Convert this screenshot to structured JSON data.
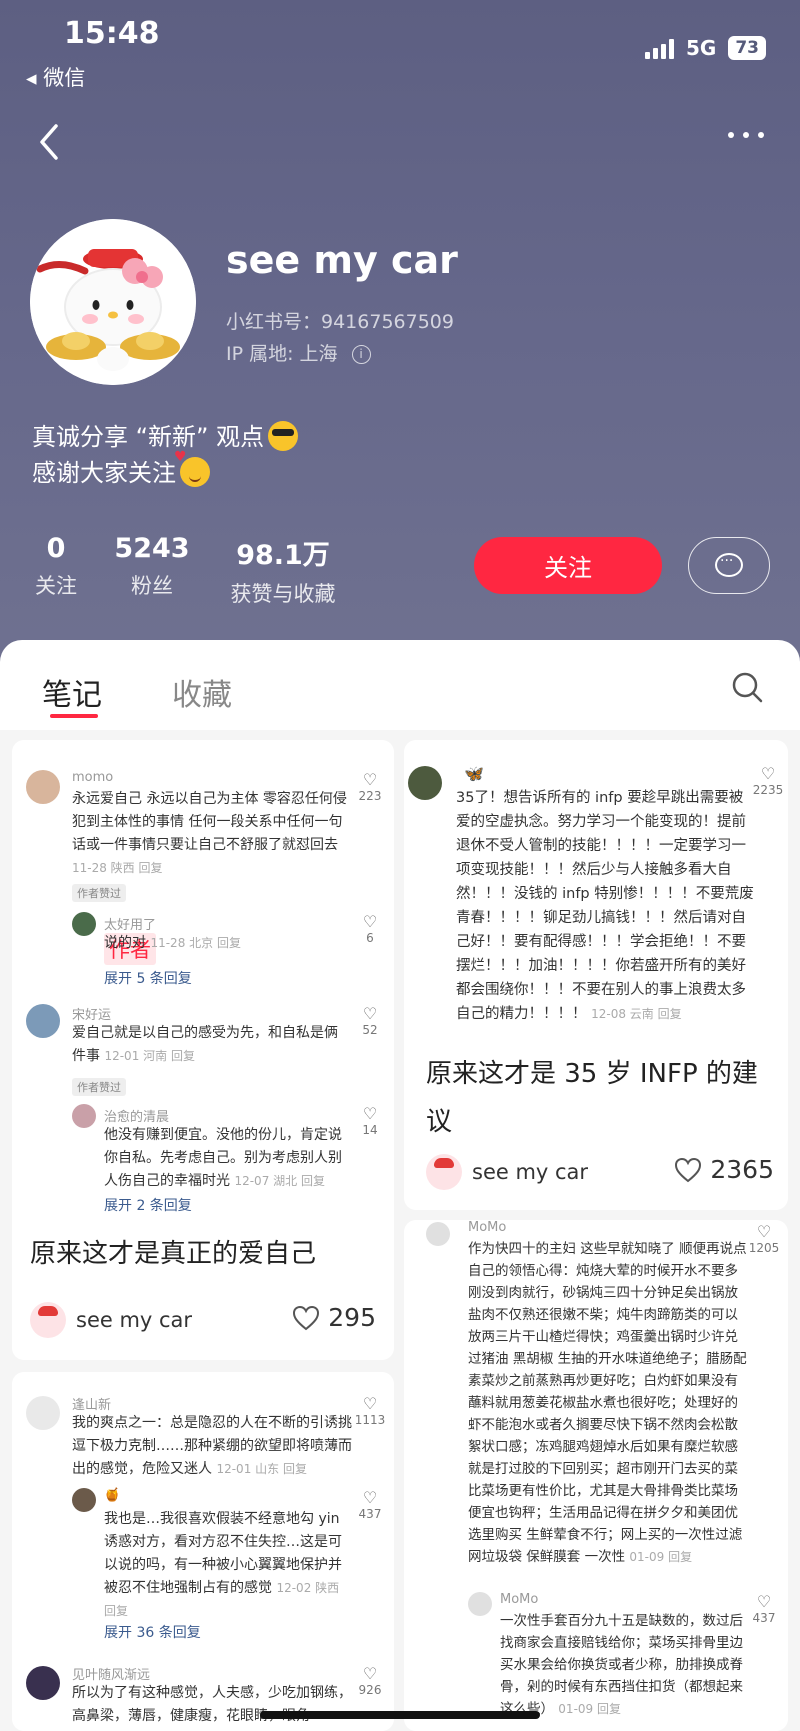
{
  "status": {
    "time": "15:48",
    "back_app": "微信",
    "network": "5G",
    "battery": "73"
  },
  "profile": {
    "name": "see my car",
    "id_line": "小红书号：94167567509",
    "ip_line": "IP 属地: 上海",
    "bio_line1": "真诚分享 “新新” 观点",
    "bio_line2": "感谢大家关注"
  },
  "stats": [
    {
      "num": "0",
      "label": "关注"
    },
    {
      "num": "5243",
      "label": "粉丝"
    },
    {
      "num": "98.1万",
      "label": "获赞与收藏"
    }
  ],
  "follow_label": "关注",
  "tabs": {
    "notes": "笔记",
    "collections": "收藏"
  },
  "cards": {
    "c1": {
      "comments": [
        {
          "name": "momo",
          "text": "永远爱自己 永远以自己为主体 零容忍任何侵犯到主体性的事情 任何一段关系中任何一句话或一件事情只要让自己不舒服了就怼回去",
          "time": "11-28 陕西 回复",
          "likes": "223",
          "tag": "作者赞过"
        },
        {
          "name": "太好用了",
          "tag": "作者",
          "text": "说的对",
          "time": "11-28 北京 回复",
          "likes": "6"
        },
        {
          "expand": "展开 5 条回复"
        },
        {
          "name": "宋好运",
          "text": "爱自己就是以自己的感受为先，和自私是俩件事",
          "time": "12-01 河南 回复",
          "likes": "52",
          "tag": "作者赞过"
        },
        {
          "name": "治愈的清晨",
          "text": "他没有赚到便宜。没他的份儿，肯定说你自私。先考虑自己。别为考虑别人别人伤自己的幸福时光",
          "time": "12-07 湖北 回复",
          "likes": "14"
        },
        {
          "expand": "展开 2 条回复"
        }
      ],
      "title": "原来这才是真正的爱自己",
      "author": "see my car",
      "likes": "295"
    },
    "c2": {
      "comment": {
        "text": "35了！想告诉所有的 infp 要趁早跳出需要被爱的空虚执念。努力学习一个能变现的！提前退休不受人管制的技能！！！！一定要学习一项变现技能！！！然后少与人接触多看大自然！！！没钱的 infp 特别惨！！！！不要荒废青春！！！！铆足劲儿搞钱！！！然后请对自己好！！要有配得感！！！学会拒绝！！不要摆烂！！！加油！！！！你若盛开所有的美好都会围绕你！！！不要在别人的事上浪费太多自己的精力！！！！",
        "time": "12-08 云南 回复",
        "likes": "2235"
      },
      "title": "原来这才是 35 岁 INFP 的建议",
      "author": "see my car",
      "likes": "2365"
    },
    "c3": {
      "comments": [
        {
          "name": "逢山新",
          "text": "我的爽点之一：总是隐忍的人在不断的引诱挑逗下极力克制……那种紧绷的欲望即将喷薄而出的感觉，危险又迷人",
          "time": "12-01 山东 回复",
          "likes": "1113"
        },
        {
          "name": "",
          "text": "我也是…我很喜欢假装不经意地勾 yin 诱惑对方，看对方忍不住失控…这是可以说的吗，有一种被小心翼翼地保护并被忍不住地强制占有的感觉",
          "time": "12-02 陕西 回复",
          "likes": "437"
        },
        {
          "expand": "展开 36 条回复"
        },
        {
          "name": "见叶随风渐远",
          "text": "所以为了有这种感觉，人夫感，少吃加钢练，高鼻梁，薄唇，健康瘦，花眼睛，眼角",
          "likes": "926"
        }
      ]
    },
    "c4": {
      "comments": [
        {
          "name": "MoMo",
          "text": "作为快四十的主妇 这些早就知晓了 顺便再说点自己的领悟心得：炖烧大荤的时候开水不要多刚没到肉就行，砂锅炖三四十分钟足矣出锅放盐肉不仅熟还很嫩不柴；炖牛肉蹄筋类的可以放两三片干山楂烂得快；鸡蛋羹出锅时少许兑过猪油 黑胡椒 生抽的开水味道绝绝子；腊肠配素菜炒之前蒸熟再炒更好吃；白灼虾如果没有蘸料就用葱姜花椒盐水煮也很好吃；处理好的虾不能泡水或者久搁要尽快下锅不然肉会松散絮状口感；冻鸡腿鸡翅焯水后如果有糜烂软感就是打过胶的下回别买；超市刚开门去买的菜比菜场更有性价比，尤其是大骨排骨类比菜场便宜也钩秤；生活用品记得在拼夕夕和美团优选里购买 生鲜荤食不行；网上买的一次性过滤网垃圾袋 保鲜膜套 一次性",
          "time": "01-09 回复",
          "likes": "1205"
        },
        {
          "name": "MoMo",
          "text": "一次性手套百分九十五是缺数的，数过后找商家会直接赔钱给你；菜场买排骨里边买水果会给你换货或者少称，肋排换成脊骨，剁的时候有东西挡住扣货（都想起来这么些）",
          "time": "01-09 回复",
          "likes": "437"
        }
      ]
    }
  }
}
